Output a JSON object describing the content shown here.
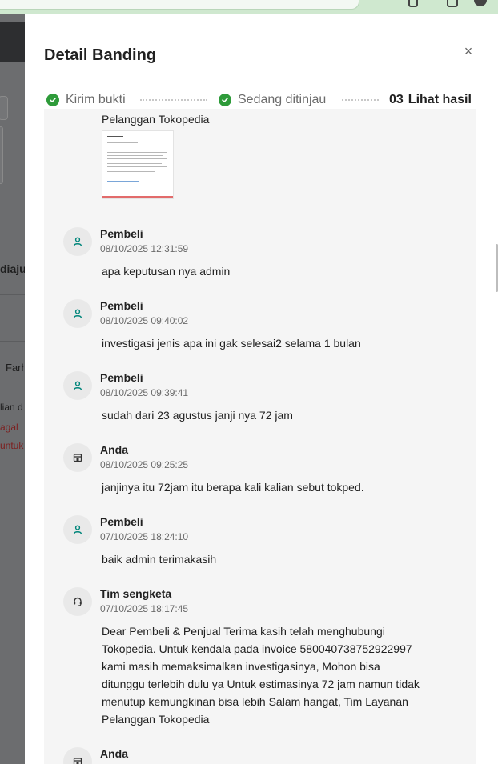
{
  "panel": {
    "title": "Detail Banding",
    "close_symbol": "×"
  },
  "stepper": {
    "steps": [
      {
        "label": "Kirim bukti",
        "status": "done"
      },
      {
        "label": "Sedang ditinjau",
        "status": "done"
      },
      {
        "number": "03",
        "label": "Lihat hasil",
        "status": "current"
      }
    ]
  },
  "attachment": {
    "caption": "Pelanggan Tokopedia"
  },
  "messages": [
    {
      "sender": "Pembeli",
      "time": "08/10/2025 12:31:59",
      "text": "apa keputusan nya admin",
      "icon": "user-icon"
    },
    {
      "sender": "Pembeli",
      "time": "08/10/2025 09:40:02",
      "text": "investigasi jenis apa ini gak selesai2 selama 1 bulan",
      "icon": "user-icon"
    },
    {
      "sender": "Pembeli",
      "time": "08/10/2025 09:39:41",
      "text": "sudah dari 23 agustus janji nya 72 jam",
      "icon": "user-icon"
    },
    {
      "sender": "Anda",
      "time": "08/10/2025 09:25:25",
      "text": "janjinya itu 72jam itu berapa kali kalian sebut tokped.",
      "icon": "store-icon"
    },
    {
      "sender": "Pembeli",
      "time": "07/10/2025 18:24:10",
      "text": "baik admin terimakasih",
      "icon": "user-icon"
    },
    {
      "sender": "Tim sengketa",
      "time": "07/10/2025 18:17:45",
      "text": "Dear Pembeli & Penjual Terima kasih telah menghubungi Tokopedia. Untuk kendala pada invoice 580040738752922997 kami masih memaksimalkan investigasinya, Mohon bisa ditunggu terlebih dulu ya Untuk estimasinya 72 jam namun tidak menutup kemungkinan bisa lebih Salam hangat, Tim Layanan Pelanggan Tokopedia",
      "icon": "headset-icon"
    },
    {
      "sender": "Anda",
      "time": "",
      "text": "",
      "icon": "store-icon"
    }
  ],
  "backdrop": {
    "fragments": [
      "diaju",
      "Farh",
      "lian d",
      "agal",
      "untuk"
    ]
  },
  "colors": {
    "success_green": "#2e9b3a",
    "chat_background": "#f5f5f5",
    "icon_teal": "#00857a"
  }
}
